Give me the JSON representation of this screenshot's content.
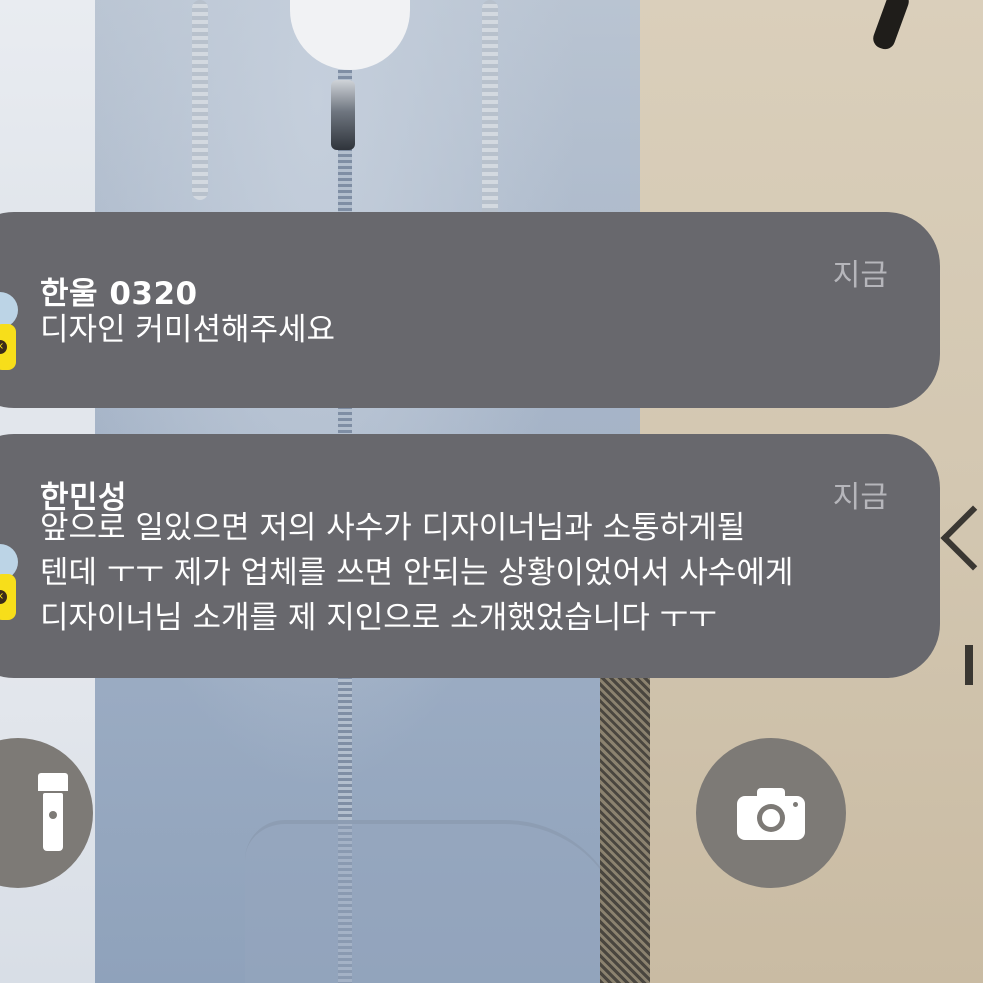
{
  "notifications": [
    {
      "app": "KakaoTalk",
      "sender": "한울 0320",
      "time": "지금",
      "message_lines": [
        "디자인 커미션해주세요"
      ]
    },
    {
      "app": "KakaoTalk",
      "sender": "한민성",
      "time": "지금",
      "message_lines": [
        "앞으로 일있으면 저의 사수가 디자이너님과 소통하게될",
        "텐데 ㅜㅜ 제가 업체를 쓰면 안되는 상황이었어서 사수에게",
        "디자이너님 소개를 제 지인으로 소개했었습니다 ㅜㅜ"
      ]
    }
  ],
  "controls": {
    "flashlight_icon": "flashlight-icon",
    "camera_icon": "camera-icon"
  },
  "colors": {
    "notification_bg": "#68686d",
    "time_text": "#b6b6bb",
    "kakao_yellow": "#f7de1a",
    "control_button_bg": "#7d7a76"
  }
}
